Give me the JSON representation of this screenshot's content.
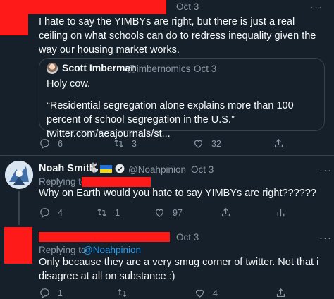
{
  "tweet1": {
    "time": "Oct 3",
    "more": "···",
    "text": "I hate to say the YIMBYs are right, but there is just a real ceiling on what schools can do to redress inequality given the way our housing market works.",
    "quote": {
      "name": "Scott Imberman",
      "handle": "@imbernomics",
      "sep": "·",
      "time": "Oct 3",
      "line1": "Holy cow.",
      "line2": "“Residential segregation alone explains more than 100 percent of school segregation in the U.S.” twitter.com/aeajournals/st..."
    },
    "actions": {
      "replies": "6",
      "retweets": "3",
      "likes": "32"
    }
  },
  "tweet2": {
    "name": "Noah Smith",
    "emoji": "🐇",
    "handle": "@Noahpinion",
    "sep": "·",
    "time": "Oct 3",
    "more": "···",
    "replying_to": "Replying to",
    "text": "Why on Earth would you hate to say YIMBYs are right??????",
    "actions": {
      "replies": "4",
      "retweets": "1",
      "likes": "97"
    }
  },
  "tweet3": {
    "time": "Oct 3",
    "more": "···",
    "replying_to": "Replying to",
    "replying_handle": "@Noahpinion",
    "text": "Only because they are a very smug corner of twitter. Not that i disagree at all on substance :)",
    "actions": {
      "replies": "1",
      "retweets": "",
      "likes": "4"
    }
  },
  "colors": {
    "background": "#15202b",
    "accent": "#1d9bf0",
    "redaction": "#ff1a1a",
    "muted": "#8b98a5"
  }
}
